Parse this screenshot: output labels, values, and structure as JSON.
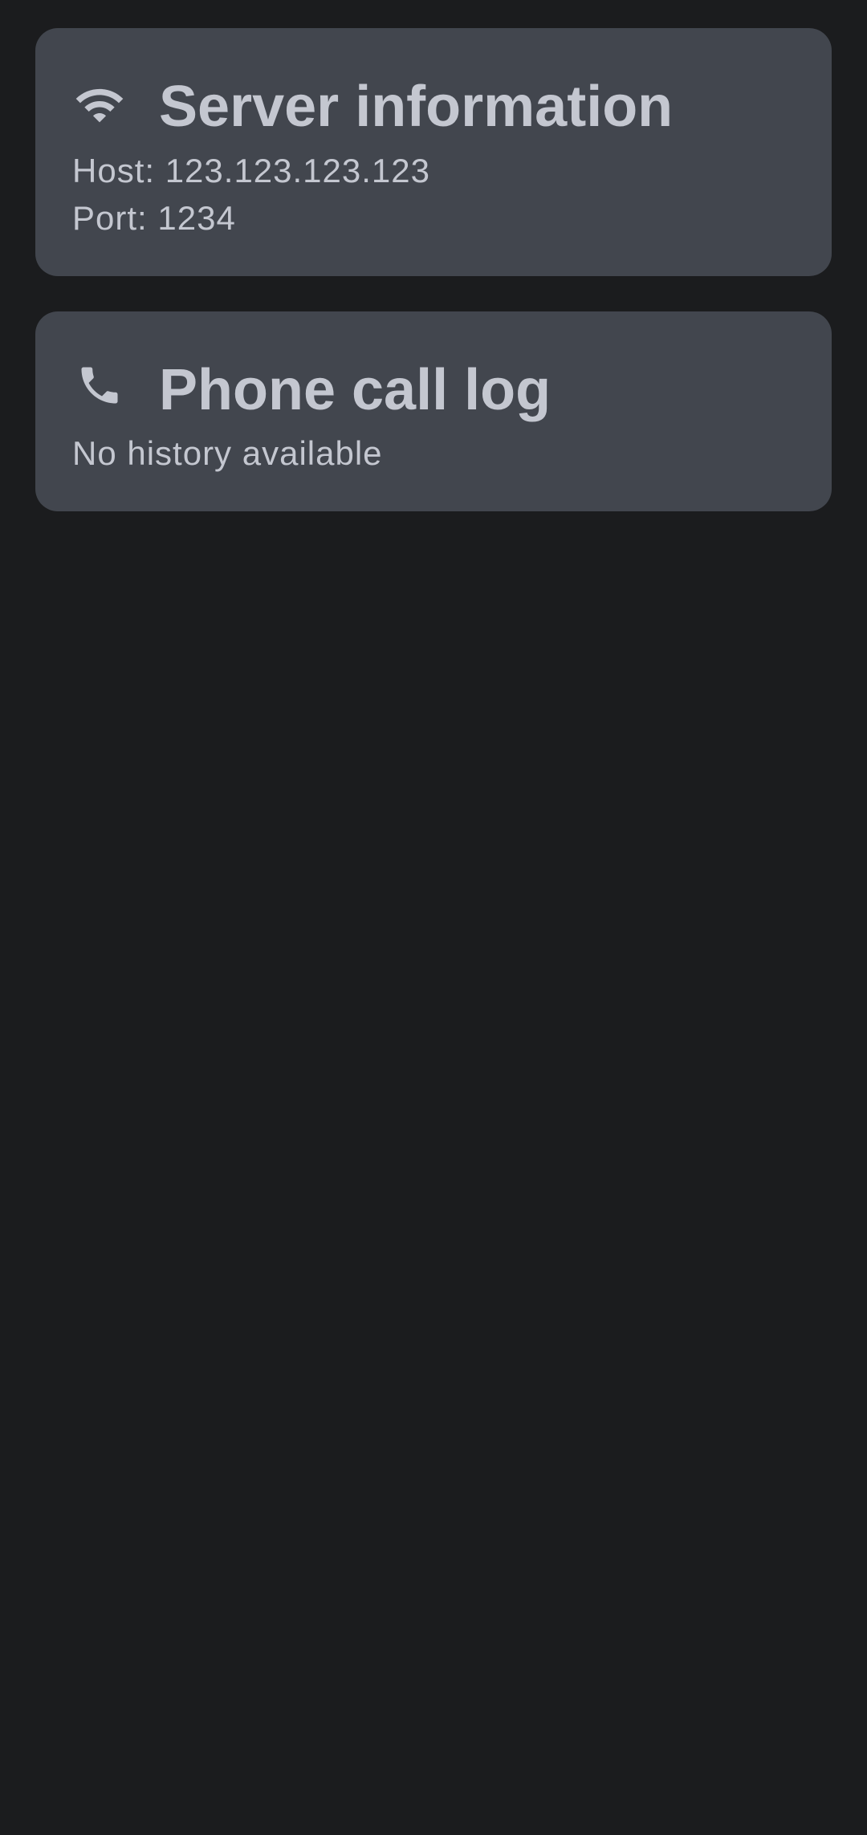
{
  "server_card": {
    "icon": "wifi-icon",
    "title": "Server information",
    "host_text": "Host: 123.123.123.123",
    "port_text": "Port: 1234"
  },
  "calls_card": {
    "icon": "phone-icon",
    "title": "Phone call log",
    "empty_text": "No history available"
  },
  "colors": {
    "background": "#1b1c1e",
    "card": "#42464e",
    "text": "#c4c7d0"
  }
}
